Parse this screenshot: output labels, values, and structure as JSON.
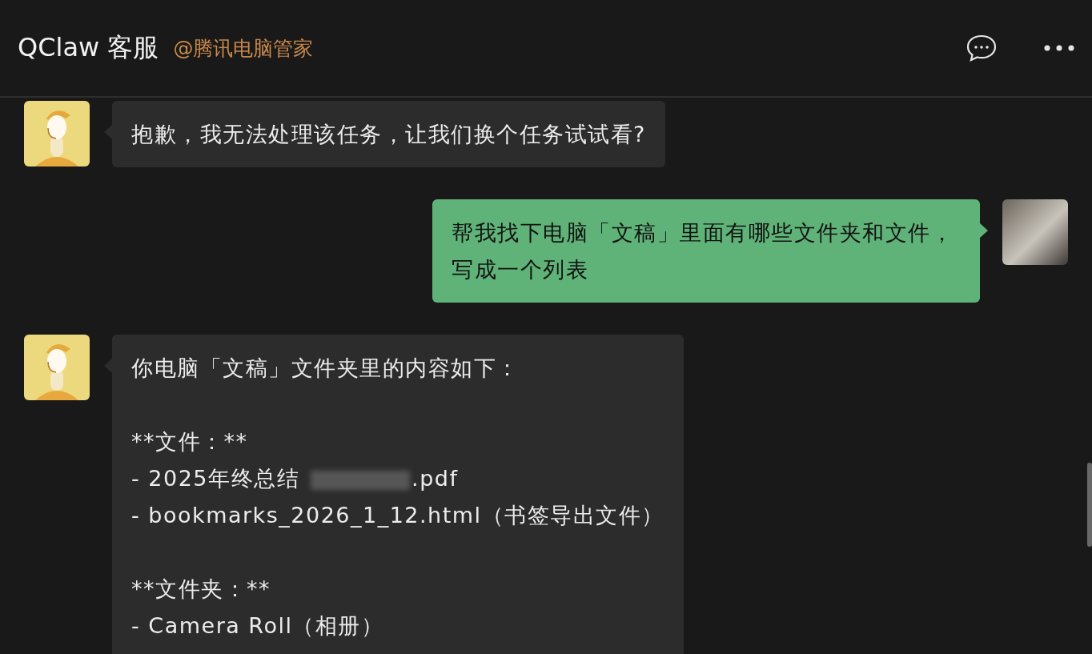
{
  "header": {
    "title": "QClaw 客服",
    "subtitle": "@腾讯电脑管家"
  },
  "messages": [
    {
      "kind": "agent",
      "blocks": [
        [
          "抱歉，我无法处理该任务，让我们换个任务试试看?"
        ]
      ]
    },
    {
      "kind": "user",
      "blocks": [
        [
          "帮我找下电脑「文稿」里面有哪些文件夹和文件，写成一个列表"
        ]
      ]
    },
    {
      "kind": "agent",
      "blocks": [
        [
          "你电脑「文稿」文件夹里的内容如下："
        ],
        [
          "**文件：**",
          {
            "kind": "redacted",
            "parts": [
              "- 2025年终总结",
              ".pdf"
            ]
          },
          "- bookmarks_2026_1_12.html（书签导出文件）"
        ],
        [
          "**文件夹：**",
          "- Camera Roll（相册）"
        ]
      ]
    }
  ]
}
